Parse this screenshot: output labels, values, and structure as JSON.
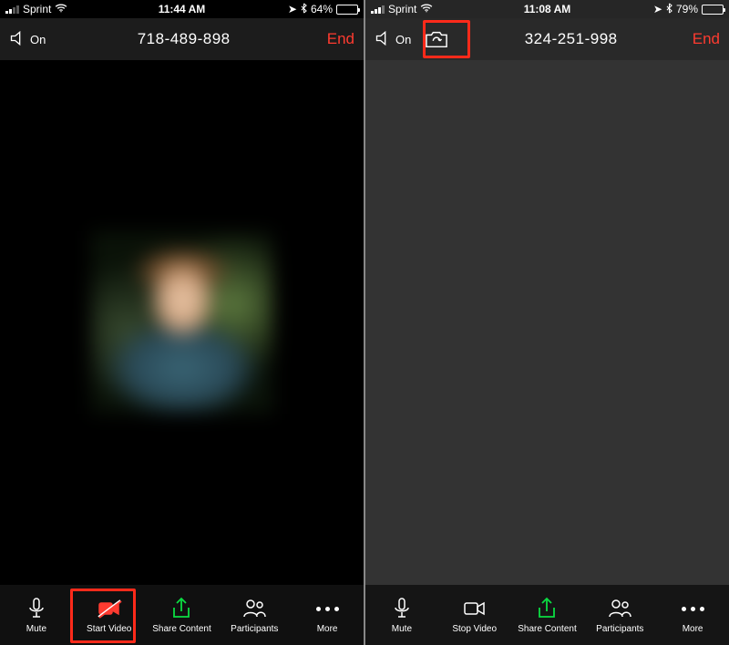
{
  "left": {
    "status": {
      "carrier": "Sprint",
      "time": "11:44 AM",
      "battery_text": "64%",
      "battery_pct": 64
    },
    "top": {
      "speaker_label": "On",
      "meeting_id": "718-489-898",
      "end_label": "End"
    },
    "toolbar": {
      "mute": "Mute",
      "video": "Start Video",
      "share": "Share Content",
      "participants": "Participants",
      "more": "More"
    }
  },
  "right": {
    "status": {
      "carrier": "Sprint",
      "time": "11:08 AM",
      "battery_text": "79%",
      "battery_pct": 79
    },
    "top": {
      "speaker_label": "On",
      "meeting_id": "324-251-998",
      "end_label": "End"
    },
    "toolbar": {
      "mute": "Mute",
      "video": "Stop Video",
      "share": "Share Content",
      "participants": "Participants",
      "more": "More"
    }
  }
}
